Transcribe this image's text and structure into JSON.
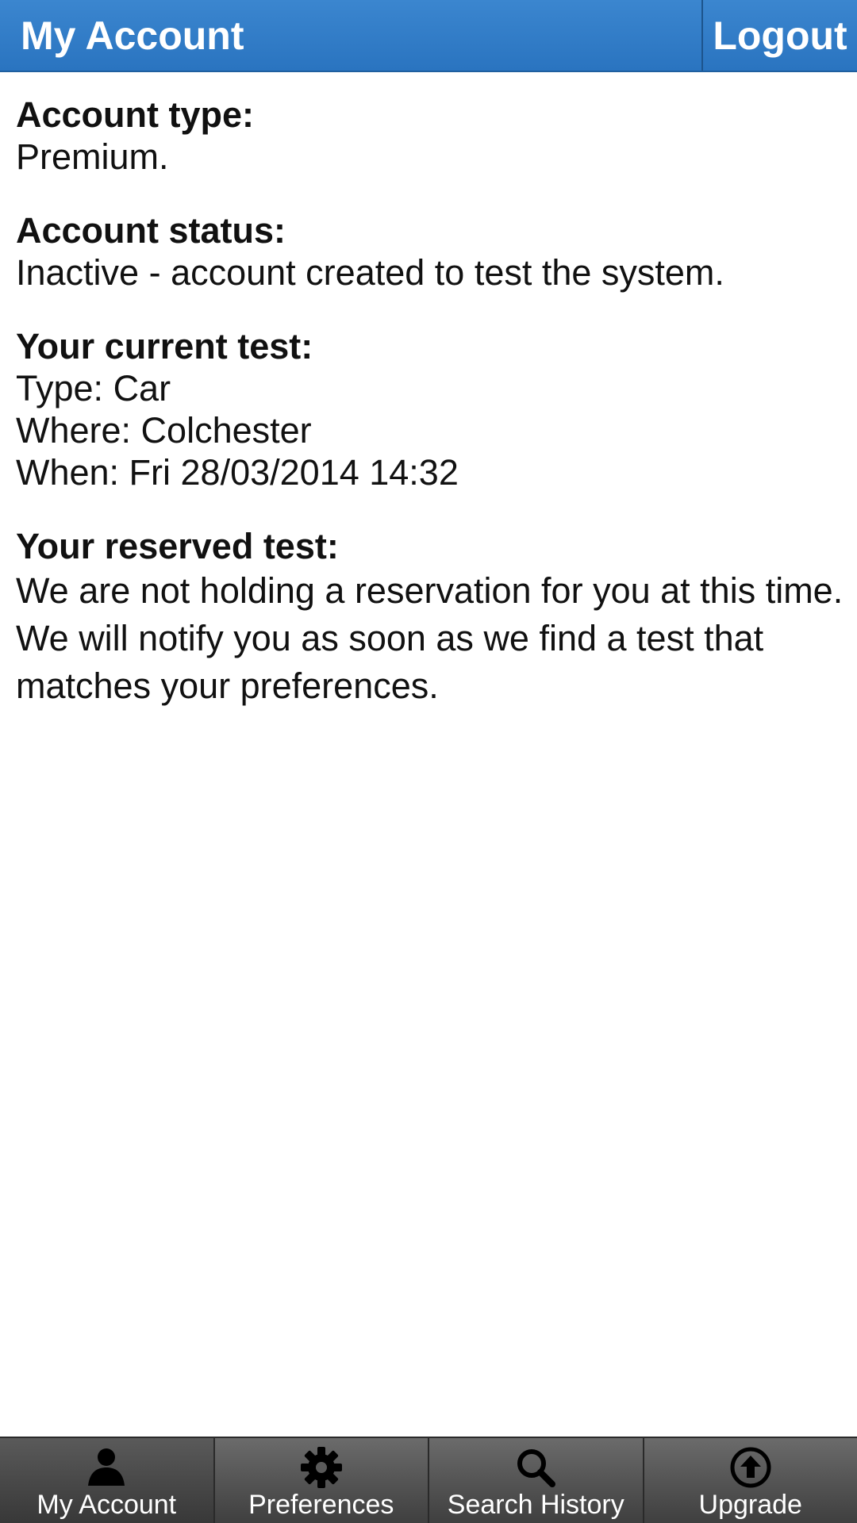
{
  "header": {
    "title": "My Account",
    "logout_label": "Logout"
  },
  "account": {
    "type_label": "Account type:",
    "type_value": "Premium.",
    "status_label": "Account status:",
    "status_value": "Inactive - account created to test the system.",
    "current_label": "Your current test:",
    "current_type": "Type: Car",
    "current_where": "Where: Colchester",
    "current_when": "When: Fri 28/03/2014 14:32",
    "reserved_label": "Your reserved test:",
    "reserved_text": "We are not holding a reservation for you at this time.  We will notify you as soon as we find a test that matches your preferences."
  },
  "tabs": [
    {
      "label": "My Account",
      "icon": "person-icon"
    },
    {
      "label": "Preferences",
      "icon": "gear-icon"
    },
    {
      "label": "Search History",
      "icon": "search-icon"
    },
    {
      "label": "Upgrade",
      "icon": "upgrade-arrow-icon"
    }
  ],
  "colors": {
    "header": "#2a74c0",
    "tabbar": "#4f4f4f"
  }
}
